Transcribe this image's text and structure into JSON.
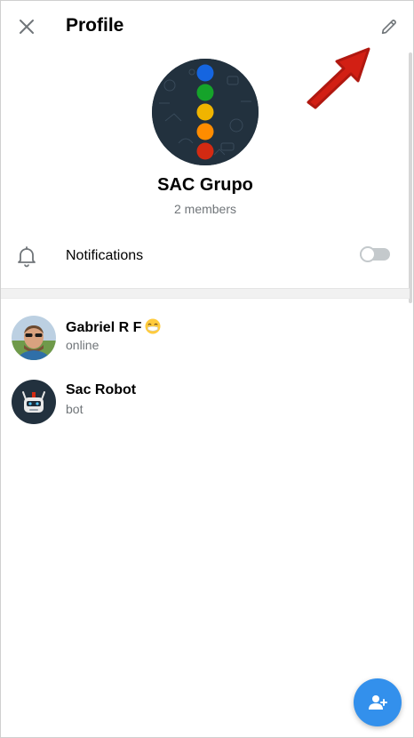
{
  "header": {
    "title": "Profile",
    "close_icon": "close-icon",
    "edit_icon": "pencil-icon"
  },
  "group": {
    "name": "SAC Grupo",
    "members_count": "2 members",
    "avatar_dots": [
      "#1565e0",
      "#15a32a",
      "#f0b400",
      "#ff8c00",
      "#d32a12"
    ]
  },
  "notifications": {
    "label": "Notifications",
    "icon": "bell-icon",
    "enabled": false
  },
  "members": [
    {
      "name": "Gabriel R F",
      "emoji": "😷",
      "status": "online",
      "avatar": "person-photo"
    },
    {
      "name": "Sac Robot",
      "status": "bot",
      "avatar": "robot-avatar"
    }
  ],
  "fab": {
    "icon": "add-member-icon"
  },
  "colors": {
    "accent": "#3390ec",
    "secondary_text": "#707579",
    "annotation_arrow": "#d21f14"
  }
}
